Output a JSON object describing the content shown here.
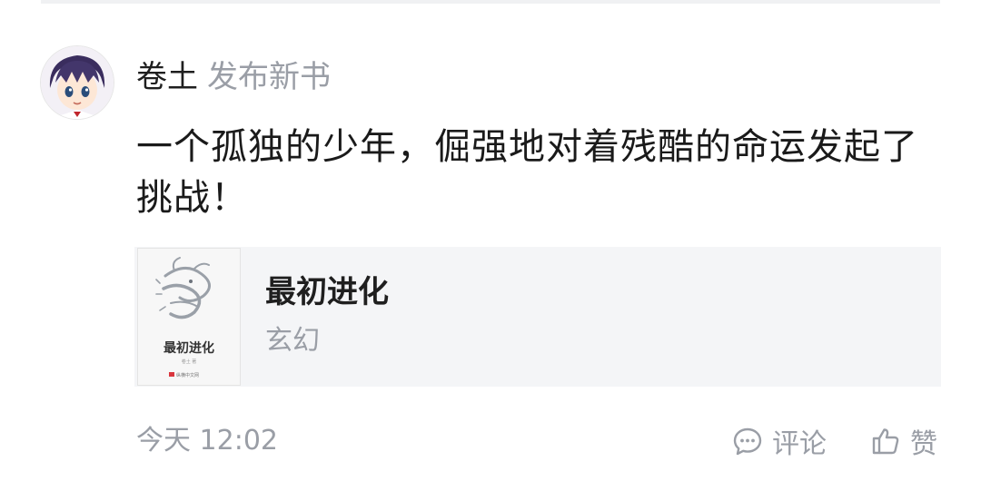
{
  "post": {
    "author_name": "卷土",
    "action_text": "发布新书",
    "content": "一个孤独的少年，倔强地对着残酷的命运发起了挑战！",
    "timestamp": "今天 12:02"
  },
  "book": {
    "title": "最初进化",
    "genre": "玄幻",
    "cover_title": "最初进化",
    "cover_author": "卷土 著",
    "cover_publisher": "纵横中文网"
  },
  "actions": {
    "comment_label": "评论",
    "like_label": "赞",
    "comment_icon": "comment-bubble-icon",
    "like_icon": "thumbs-up-icon"
  },
  "colors": {
    "primary_text": "#1f1f1f",
    "secondary_text": "#9a9ea6",
    "card_background": "#f4f5f7"
  }
}
